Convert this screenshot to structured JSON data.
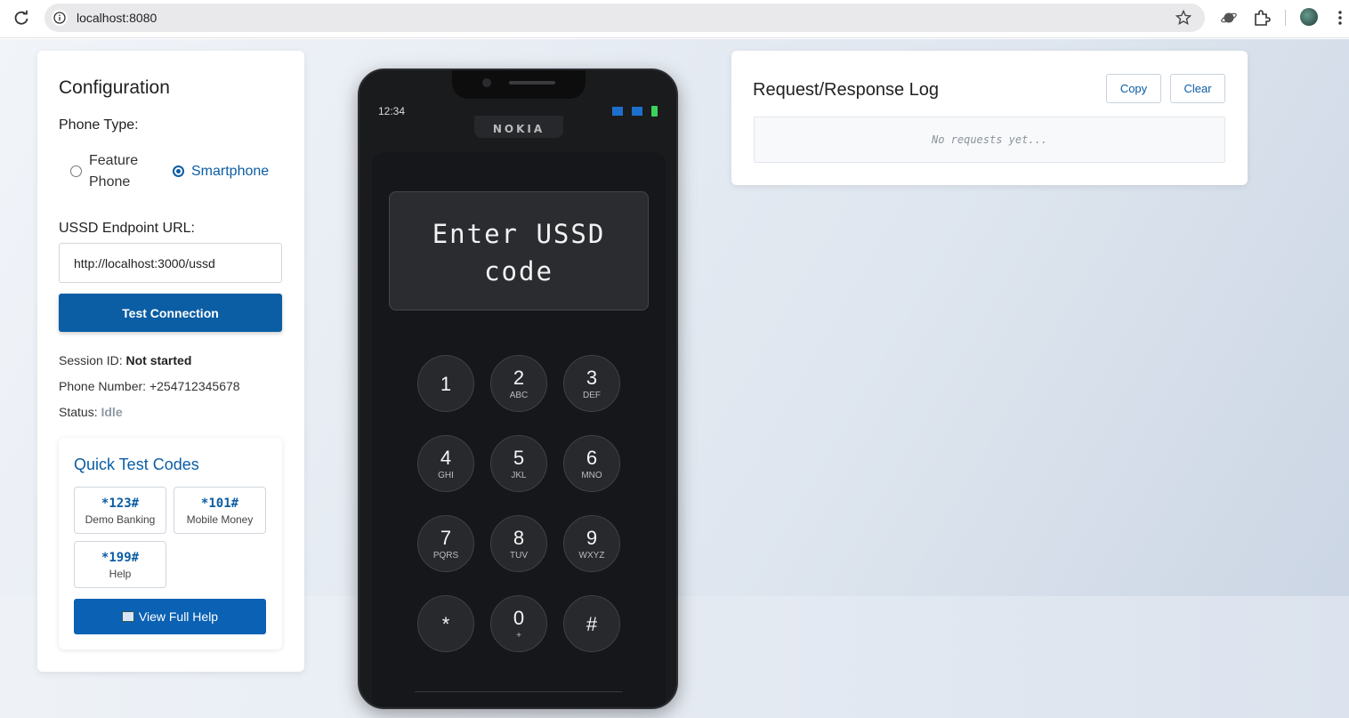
{
  "browser": {
    "url": "localhost:8080"
  },
  "config": {
    "title": "Configuration",
    "phone_type_label": "Phone Type:",
    "phone_types": [
      {
        "label_line1": "Feature",
        "label_line2": "Phone",
        "selected": false
      },
      {
        "label": "Smartphone",
        "selected": true
      }
    ],
    "endpoint_label": "USSD Endpoint URL:",
    "endpoint_value": "http://localhost:3000/ussd",
    "test_button": "Test Connection",
    "session_label": "Session ID:",
    "session_value": "Not started",
    "phone_label": "Phone Number:",
    "phone_value": "+254712345678",
    "status_label": "Status:",
    "status_value": "Idle"
  },
  "quick": {
    "title": "Quick Test Codes",
    "codes": [
      {
        "code": "*123#",
        "desc": "Demo Banking"
      },
      {
        "code": "*101#",
        "desc": "Mobile Money"
      },
      {
        "code": "*199#",
        "desc": "Help"
      }
    ],
    "help_button": "View Full Help"
  },
  "phone": {
    "time": "12:34",
    "brand": "NOKIA",
    "display_line1": "Enter USSD",
    "display_line2": "code",
    "keys": [
      {
        "n": "1",
        "l": ""
      },
      {
        "n": "2",
        "l": "ABC"
      },
      {
        "n": "3",
        "l": "DEF"
      },
      {
        "n": "4",
        "l": "GHI"
      },
      {
        "n": "5",
        "l": "JKL"
      },
      {
        "n": "6",
        "l": "MNO"
      },
      {
        "n": "7",
        "l": "PQRS"
      },
      {
        "n": "8",
        "l": "TUV"
      },
      {
        "n": "9",
        "l": "WXYZ"
      },
      {
        "n": "*",
        "l": ""
      },
      {
        "n": "0",
        "l": "+"
      },
      {
        "n": "#",
        "l": ""
      }
    ]
  },
  "log": {
    "title": "Request/Response Log",
    "copy_button": "Copy",
    "clear_button": "Clear",
    "empty_text": "No requests yet..."
  },
  "colors": {
    "primary": "#0b5da4",
    "phone_body": "#1a1b1d",
    "battery": "#3cd25a"
  }
}
